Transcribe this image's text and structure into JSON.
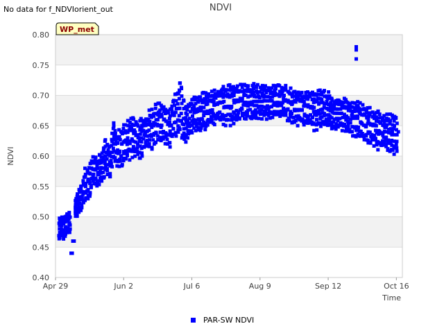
{
  "notice": "No data for f_NDVIorient_out",
  "badge": "WP_met",
  "colors": {
    "series": "#0000ff",
    "band": "#f2f2f2",
    "grid": "#dddddd",
    "badge_bg": "#ffffc0"
  },
  "chart_data": {
    "type": "scatter",
    "title": "NDVI",
    "xlabel": "Time",
    "ylabel": "NDVI",
    "xlim": [
      "2024-04-29",
      "2024-10-19"
    ],
    "ylim": [
      0.4,
      0.8
    ],
    "grid": "horizontal bands",
    "legend_position": "bottom-center",
    "x_ticks": [
      {
        "date": "2024-04-29",
        "label": "Apr 29"
      },
      {
        "date": "2024-06-02",
        "label": "Jun 2"
      },
      {
        "date": "2024-07-06",
        "label": "Jul 6"
      },
      {
        "date": "2024-08-09",
        "label": "Aug 9"
      },
      {
        "date": "2024-09-12",
        "label": "Sep 12"
      },
      {
        "date": "2024-10-16",
        "label": "Oct 16"
      }
    ],
    "y_ticks": [
      "0.40",
      "0.45",
      "0.50",
      "0.55",
      "0.60",
      "0.65",
      "0.70",
      "0.75",
      "0.80"
    ],
    "series": [
      {
        "name": "PAR-SW NDVI",
        "color": "#0000ff",
        "x": [
          "2024-05-01",
          "2024-05-02",
          "2024-05-03",
          "2024-05-05",
          "2024-05-06",
          "2024-05-07",
          "2024-05-08",
          "2024-05-09",
          "2024-05-10",
          "2024-05-12",
          "2024-05-14",
          "2024-05-16",
          "2024-05-18",
          "2024-05-20",
          "2024-05-22",
          "2024-05-24",
          "2024-05-26",
          "2024-05-28",
          "2024-05-30",
          "2024-06-01",
          "2024-06-04",
          "2024-06-07",
          "2024-06-10",
          "2024-06-13",
          "2024-06-16",
          "2024-06-19",
          "2024-06-22",
          "2024-06-25",
          "2024-06-27",
          "2024-06-30",
          "2024-07-03",
          "2024-07-07",
          "2024-07-12",
          "2024-07-17",
          "2024-07-22",
          "2024-07-27",
          "2024-08-01",
          "2024-08-06",
          "2024-08-11",
          "2024-08-16",
          "2024-08-21",
          "2024-08-26",
          "2024-08-31",
          "2024-09-05",
          "2024-09-10",
          "2024-09-15",
          "2024-09-20",
          "2024-09-24",
          "2024-09-28",
          "2024-10-02",
          "2024-10-06",
          "2024-10-10",
          "2024-10-14",
          "2024-10-17"
        ],
        "y": [
          0.48,
          0.49,
          0.47,
          0.5,
          0.49,
          0.44,
          0.46,
          0.52,
          0.51,
          0.53,
          0.55,
          0.56,
          0.57,
          0.58,
          0.58,
          0.6,
          0.59,
          0.62,
          0.61,
          0.62,
          0.63,
          0.64,
          0.63,
          0.64,
          0.65,
          0.66,
          0.66,
          0.65,
          0.67,
          0.72,
          0.66,
          0.68,
          0.68,
          0.69,
          0.69,
          0.7,
          0.7,
          0.7,
          0.7,
          0.7,
          0.7,
          0.69,
          0.69,
          0.68,
          0.68,
          0.68,
          0.68,
          0.67,
          0.67,
          0.66,
          0.65,
          0.65,
          0.64,
          0.64
        ],
        "y_min": [
          0.46,
          0.47,
          0.46,
          0.47,
          0.47,
          0.44,
          0.46,
          0.5,
          0.5,
          0.51,
          0.52,
          0.53,
          0.55,
          0.55,
          0.55,
          0.57,
          0.56,
          0.59,
          0.58,
          0.58,
          0.59,
          0.6,
          0.59,
          0.61,
          0.61,
          0.62,
          0.62,
          0.61,
          0.63,
          0.63,
          0.62,
          0.64,
          0.64,
          0.65,
          0.65,
          0.65,
          0.66,
          0.66,
          0.66,
          0.66,
          0.66,
          0.65,
          0.65,
          0.64,
          0.65,
          0.64,
          0.64,
          0.63,
          0.63,
          0.62,
          0.61,
          0.61,
          0.6,
          0.6
        ],
        "y_max": [
          0.5,
          0.5,
          0.5,
          0.51,
          0.51,
          0.44,
          0.46,
          0.53,
          0.54,
          0.56,
          0.58,
          0.59,
          0.6,
          0.6,
          0.61,
          0.63,
          0.62,
          0.66,
          0.64,
          0.65,
          0.66,
          0.67,
          0.66,
          0.67,
          0.68,
          0.69,
          0.69,
          0.68,
          0.7,
          0.73,
          0.69,
          0.7,
          0.71,
          0.71,
          0.72,
          0.72,
          0.72,
          0.72,
          0.72,
          0.72,
          0.72,
          0.71,
          0.71,
          0.71,
          0.71,
          0.7,
          0.7,
          0.69,
          0.69,
          0.68,
          0.68,
          0.67,
          0.67,
          0.67
        ],
        "outliers": [
          {
            "x": "2024-09-26",
            "y": 0.78
          },
          {
            "x": "2024-09-26",
            "y": 0.775
          },
          {
            "x": "2024-09-26",
            "y": 0.76
          }
        ]
      }
    ]
  }
}
